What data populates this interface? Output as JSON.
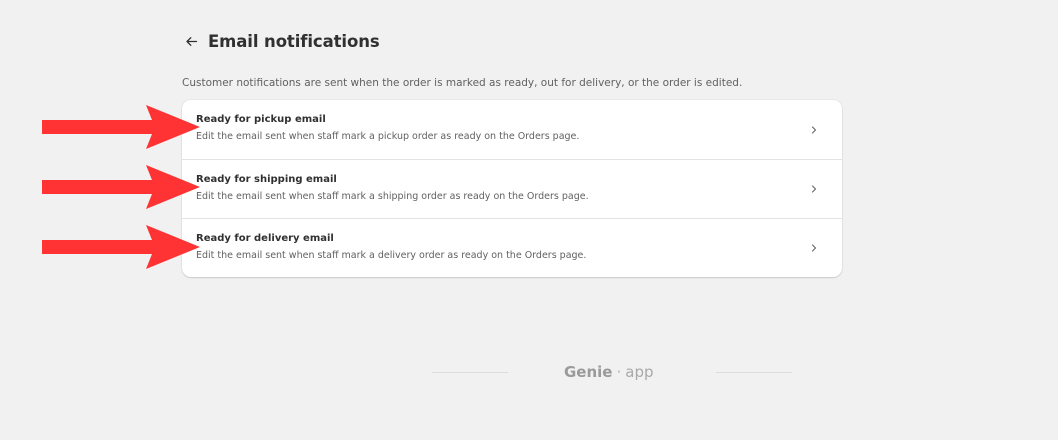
{
  "header": {
    "title": "Email notifications",
    "back_icon": "arrow-left-icon"
  },
  "description": "Customer notifications are sent when the order is marked as ready, out for delivery, or the order is edited.",
  "notifications": [
    {
      "title": "Ready for pickup email",
      "description": "Edit the email sent when staff mark a pickup order as ready on the Orders page."
    },
    {
      "title": "Ready for shipping email",
      "description": "Edit the email sent when staff mark a shipping order as ready on the Orders page."
    },
    {
      "title": "Ready for delivery email",
      "description": "Edit the email sent when staff mark a delivery order as ready on the Orders page."
    }
  ],
  "footer": {
    "brand_name": "Genie",
    "separator": "·",
    "brand_suffix": "app"
  },
  "colors": {
    "background": "#f1f1f1",
    "card": "#ffffff",
    "annotation_arrow": "#ff3333",
    "text_primary": "#303030",
    "text_secondary": "#616161"
  }
}
